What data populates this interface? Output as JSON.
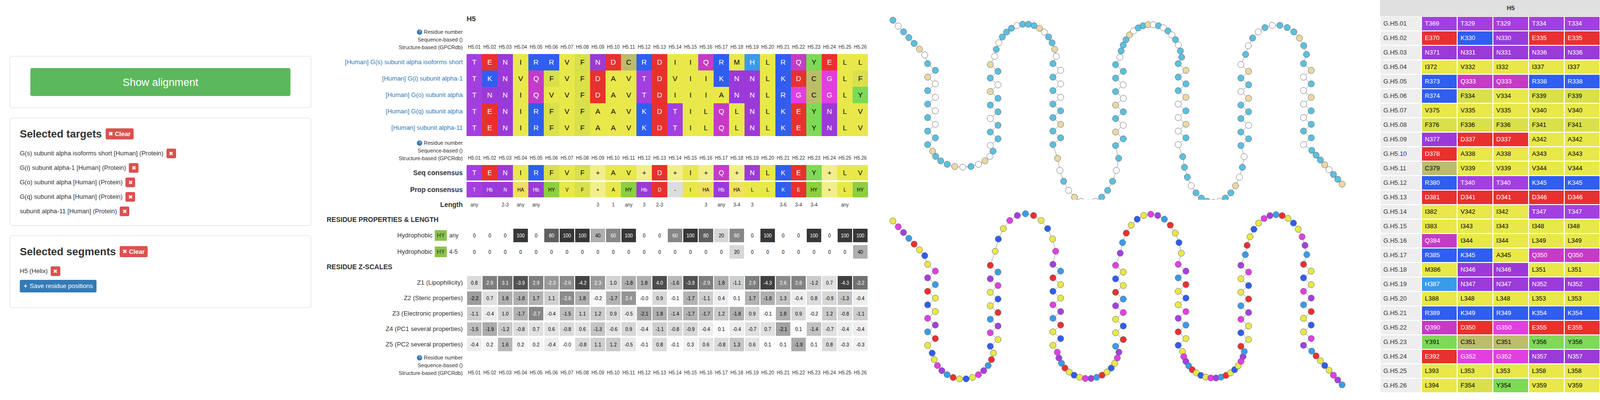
{
  "left_panel": {
    "show_alignment_button": "Show alignment",
    "remove_icon": "✖",
    "selected_targets": {
      "title": "Selected targets",
      "clear": "Clear",
      "items": [
        {
          "label": "G(s) subunit alpha isoforms short [Human] (Protein)"
        },
        {
          "label": "G(i) subunit alpha-1 [Human] (Protein)"
        },
        {
          "label": "G(o) subunit alpha [Human] (Protein)"
        },
        {
          "label": "G(q) subunit alpha [Human] (Protein)"
        },
        {
          "label": "subunit alpha-11 [Human] (Protein)"
        }
      ]
    },
    "selected_segments": {
      "title": "Selected segments",
      "clear": "Clear",
      "items": [
        {
          "label": "H5 (Helix)"
        }
      ],
      "save_icon": "+",
      "save_button": "Save residue positions"
    }
  },
  "alignment": {
    "title": "H5",
    "help_icon": "?",
    "header_labels": [
      "Residue number",
      "Sequence-based ()",
      "Structure-based (GPCRdb)"
    ],
    "residue_numbers": [
      "H5.01",
      "H5.02",
      "H5.03",
      "H5.04",
      "H5.05",
      "H5.06",
      "H5.07",
      "H5.08",
      "H5.09",
      "H5.10",
      "H5.11",
      "H5.12",
      "H5.13",
      "H5.14",
      "H5.15",
      "H5.16",
      "H5.17",
      "H5.18",
      "H5.19",
      "H5.20",
      "H5.21",
      "H5.22",
      "H5.23",
      "H5.24",
      "H5.25",
      "H5.26"
    ],
    "sequences": [
      {
        "name": "[Human] G(s) subunit alpha isoforms short",
        "residues": [
          "T",
          "E",
          "N",
          "I",
          "R",
          "R",
          "V",
          "F",
          "N",
          "D",
          "C",
          "R",
          "D",
          "I",
          "I",
          "Q",
          "R",
          "M",
          "H",
          "L",
          "R",
          "Q",
          "Y",
          "E",
          "L",
          "L"
        ]
      },
      {
        "name": "[Human] G(i) subunit alpha-1",
        "residues": [
          "T",
          "K",
          "N",
          "V",
          "Q",
          "F",
          "V",
          "F",
          "D",
          "A",
          "V",
          "T",
          "D",
          "V",
          "I",
          "I",
          "K",
          "N",
          "N",
          "L",
          "K",
          "D",
          "C",
          "G",
          "L",
          "F"
        ]
      },
      {
        "name": "[Human] G(o) subunit alpha",
        "residues": [
          "T",
          "N",
          "N",
          "I",
          "Q",
          "V",
          "V",
          "F",
          "D",
          "A",
          "V",
          "T",
          "D",
          "I",
          "I",
          "I",
          "A",
          "N",
          "N",
          "L",
          "R",
          "G",
          "C",
          "G",
          "L",
          "Y"
        ]
      },
      {
        "name": "[Human] G(q) subunit alpha",
        "residues": [
          "T",
          "E",
          "N",
          "I",
          "R",
          "F",
          "V",
          "F",
          "A",
          "A",
          "V",
          "K",
          "D",
          "T",
          "I",
          "L",
          "Q",
          "L",
          "N",
          "L",
          "K",
          "E",
          "Y",
          "N",
          "L",
          "V"
        ]
      },
      {
        "name": "[Human] subunit alpha-11",
        "residues": [
          "T",
          "E",
          "N",
          "I",
          "R",
          "F",
          "V",
          "F",
          "A",
          "A",
          "V",
          "K",
          "D",
          "T",
          "I",
          "L",
          "Q",
          "L",
          "N",
          "L",
          "K",
          "E",
          "Y",
          "N",
          "L",
          "V"
        ]
      }
    ],
    "seq_consensus": {
      "label": "Seq consensus",
      "residues": [
        "T",
        "E",
        "N",
        "I",
        "R",
        "F",
        "V",
        "F",
        "+",
        "A",
        "V",
        "+",
        "D",
        "+",
        "I",
        "+",
        "Q",
        "+",
        "N",
        "L",
        "K",
        "E",
        "Y",
        "+",
        "L",
        "V"
      ]
    },
    "prop_consensus": {
      "label": "Prop consensus",
      "items": [
        {
          "text": "T",
          "color": "#a33fe0"
        },
        {
          "text": "Hb",
          "color": "#9b3ad8"
        },
        {
          "text": "N",
          "color": "#9b3ad8"
        },
        {
          "text": "HA",
          "color": "#f0e060"
        },
        {
          "text": "Hb",
          "color": "#9b3ad8"
        },
        {
          "text": "HY",
          "color": "#8ccf3f"
        },
        {
          "text": "V",
          "color": "#e8e84a"
        },
        {
          "text": "F",
          "color": "#d9e04a"
        },
        {
          "text": "+",
          "color": "#f2ee8c"
        },
        {
          "text": "A",
          "color": "#e8e84a"
        },
        {
          "text": "HY",
          "color": "#8ccf3f"
        },
        {
          "text": "Hb",
          "color": "#9b3ad8"
        },
        {
          "text": "D",
          "color": "#e8312f"
        },
        {
          "text": "-",
          "color": "#dddddd"
        },
        {
          "text": "I",
          "color": "#e8e84a"
        },
        {
          "text": "HA",
          "color": "#f0e060"
        },
        {
          "text": "Hb",
          "color": "#9b3ad8"
        },
        {
          "text": "HA",
          "color": "#f0e060"
        },
        {
          "text": "L",
          "color": "#e8e84a"
        },
        {
          "text": "L",
          "color": "#e8e84a"
        },
        {
          "text": "K",
          "color": "#2f5ef0"
        },
        {
          "text": "E",
          "color": "#e8312f"
        },
        {
          "text": "HY",
          "color": "#8ccf3f"
        },
        {
          "text": "+",
          "color": "#f2ee8c"
        },
        {
          "text": "L",
          "color": "#e8e84a"
        },
        {
          "text": "HY",
          "color": "#8ccf3f"
        }
      ]
    },
    "length": {
      "label": "Length",
      "values": [
        "any",
        "",
        "2-3",
        "any",
        "any",
        "",
        "",
        "",
        "3",
        "1",
        "any",
        "3",
        "2-3",
        "",
        "",
        "3",
        "any",
        "3-4",
        "3",
        "",
        "3-6",
        "3-4",
        "3-4",
        "",
        "any",
        ""
      ]
    },
    "properties_title": "RESIDUE PROPERTIES & LENGTH",
    "property_rows": [
      {
        "label": "Hydrophobic",
        "badge": "HY",
        "badge_color": "#8bc34a",
        "qualifier": "any",
        "values": [
          "0",
          "0",
          "0",
          "100",
          "0",
          "80",
          "100",
          "100",
          "40",
          "60",
          "100",
          "0",
          "0",
          "60",
          "100",
          "80",
          "20",
          "60",
          "0",
          "100",
          "0",
          "0",
          "100",
          "0",
          "100",
          "100"
        ]
      },
      {
        "label": "Hydrophobic",
        "badge": "HY",
        "badge_color": "#8bc34a",
        "qualifier": "4-5",
        "values": [
          "0",
          "0",
          "0",
          "0",
          "0",
          "0",
          "0",
          "0",
          "0",
          "0",
          "0",
          "0",
          "0",
          "0",
          "0",
          "0",
          "0",
          "20",
          "0",
          "0",
          "0",
          "0",
          "0",
          "0",
          "0",
          "40"
        ]
      }
    ],
    "zscales_title": "RESIDUE Z-SCALES",
    "zscale_rows": [
      {
        "label": "Z1 (Lipophilicity)",
        "values": [
          "0.8",
          "2.9",
          "3.1",
          "-3.9",
          "2.9",
          "-2.3",
          "-2.6",
          "-4.2",
          "2.3",
          "1.0",
          "-1.8",
          "1.8",
          "4.0",
          "-1.6",
          "-3.9",
          "-2.9",
          "1.8",
          "-1.1",
          "2.9",
          "-4.3",
          "2.6",
          "2.8",
          "-1.2",
          "0.7",
          "-4.3",
          "-3.2"
        ]
      },
      {
        "label": "Z2 (Steric properties)",
        "values": [
          "-2.2",
          "0.7",
          "1.8",
          "-1.8",
          "1.7",
          "1.1",
          "-2.6",
          "1.8",
          "-0.2",
          "-1.7",
          "2.4",
          "-0.0",
          "0.9",
          "-0.1",
          "-1.7",
          "-1.1",
          "0.4",
          "0.1",
          "1.7",
          "-1.8",
          "1.3",
          "-0.4",
          "0.8",
          "-0.9",
          "-1.3",
          "-0.4"
        ]
      },
      {
        "label": "Z3 (Electronic properties)",
        "values": [
          "-1.1",
          "-0.4",
          "1.0",
          "-1.7",
          "-2.7",
          "-0.4",
          "-1.5",
          "1.1",
          "1.2",
          "0.9",
          "-0.5",
          "-2.1",
          "1.8",
          "-1.4",
          "-1.7",
          "-1.7",
          "1.2",
          "-1.8",
          "0.9",
          "-0.1",
          "1.8",
          "0.9",
          "-0.2",
          "1.2",
          "-0.8",
          "-1.1"
        ]
      },
      {
        "label": "Z4 (PC1 several properties)",
        "values": [
          "-1.5",
          "-1.9",
          "-1.2",
          "-0.8",
          "0.7",
          "0.6",
          "-0.8",
          "0.6",
          "-1.3",
          "-0.6",
          "0.9",
          "-0.4",
          "-1.1",
          "-0.8",
          "-0.9",
          "-0.4",
          "0.1",
          "-0.4",
          "-0.7",
          "0.7",
          "-2.1",
          "0.1",
          "-1.4",
          "-0.7",
          "-0.4",
          "-0.4"
        ]
      },
      {
        "label": "Z5 (PC2 several properties)",
        "values": [
          "-0.4",
          "0.2",
          "1.6",
          "0.2",
          "0.2",
          "-0.4",
          "-0.0",
          "-0.8",
          "1.1",
          "1.2",
          "-0.5",
          "-0.1",
          "0.8",
          "-0.1",
          "0.3",
          "0.6",
          "-0.8",
          "1.3",
          "0.6",
          "0.1",
          "0.1",
          "-1.9",
          "0.1",
          "0.8",
          "-0.3",
          "-0.3"
        ]
      }
    ]
  },
  "residue_colors": {
    "A": "#e8e84a",
    "I": "#e8e84a",
    "L": "#e8e84a",
    "V": "#e8e84a",
    "M": "#e8e84a",
    "F": "#d9e04a",
    "Y": "#7ed957",
    "W": "#7ed957",
    "C": "#bcbc6a",
    "G": "#e040e0",
    "P": "#c8a2c8",
    "S": "#a33fe0",
    "T": "#a33fe0",
    "N": "#9b3ad8",
    "Q": "#c53bc5",
    "D": "#e8312f",
    "E": "#e8312f",
    "K": "#2f5ef0",
    "R": "#2f5ef0",
    "H": "#3a9be8",
    "+": "#f2ee8c",
    "-": "#dddddd"
  },
  "snake_plots": [
    {
      "colors": [
        "#5bc0de",
        "#5bc0de",
        "#ffffff",
        "#5bc0de",
        "#e9d8a6",
        "#ffffff",
        "#5bc0de"
      ]
    },
    {
      "colors": [
        "#e8e84a",
        "#a33fe0",
        "#e8312f",
        "#2f5ef0",
        "#8ccf3f",
        "#e040e0",
        "#3a9be8",
        "#e8e84a",
        "#f0a030"
      ]
    }
  ],
  "table": {
    "title": "H5",
    "rows": [
      {
        "label": "G.H5.01",
        "cells": [
          "T369",
          "T329",
          "T329",
          "T334",
          "T334"
        ]
      },
      {
        "label": "G.H5.02",
        "cells": [
          "E370",
          "K330",
          "N330",
          "E335",
          "E335"
        ]
      },
      {
        "label": "G.H5.03",
        "cells": [
          "N371",
          "N331",
          "N331",
          "N336",
          "N336"
        ]
      },
      {
        "label": "G.H5.04",
        "cells": [
          "I372",
          "V332",
          "I332",
          "I337",
          "I337"
        ]
      },
      {
        "label": "G.H5.05",
        "cells": [
          "R373",
          "Q333",
          "Q333",
          "R338",
          "R338"
        ]
      },
      {
        "label": "G.H5.06",
        "cells": [
          "R374",
          "F334",
          "V334",
          "F339",
          "F339"
        ]
      },
      {
        "label": "G.H5.07",
        "cells": [
          "V375",
          "V335",
          "V335",
          "V340",
          "V340"
        ]
      },
      {
        "label": "G.H5.08",
        "cells": [
          "F376",
          "F336",
          "F336",
          "F341",
          "F341"
        ]
      },
      {
        "label": "G.H5.09",
        "cells": [
          "N377",
          "D337",
          "D337",
          "A342",
          "A342"
        ]
      },
      {
        "label": "G.H5.10",
        "cells": [
          "D378",
          "A338",
          "A338",
          "A343",
          "A343"
        ]
      },
      {
        "label": "G.H5.11",
        "cells": [
          "C379",
          "V339",
          "V339",
          "V344",
          "V344"
        ]
      },
      {
        "label": "G.H5.12",
        "cells": [
          "R380",
          "T340",
          "T340",
          "K345",
          "K345"
        ]
      },
      {
        "label": "G.H5.13",
        "cells": [
          "D381",
          "D341",
          "D341",
          "D346",
          "D346"
        ]
      },
      {
        "label": "G.H5.14",
        "cells": [
          "I382",
          "V342",
          "I342",
          "T347",
          "T347"
        ]
      },
      {
        "label": "G.H5.15",
        "cells": [
          "I383",
          "I343",
          "I343",
          "I348",
          "I348"
        ]
      },
      {
        "label": "G.H5.16",
        "cells": [
          "Q384",
          "I344",
          "I344",
          "L349",
          "L349"
        ]
      },
      {
        "label": "G.H5.17",
        "cells": [
          "R385",
          "K345",
          "A345",
          "Q350",
          "Q350"
        ]
      },
      {
        "label": "G.H5.18",
        "cells": [
          "M386",
          "N346",
          "N346",
          "L351",
          "L351"
        ]
      },
      {
        "label": "G.H5.19",
        "cells": [
          "H387",
          "N347",
          "N347",
          "N352",
          "N352"
        ]
      },
      {
        "label": "G.H5.20",
        "cells": [
          "L388",
          "L348",
          "L348",
          "L353",
          "L353"
        ]
      },
      {
        "label": "G.H5.21",
        "cells": [
          "R389",
          "K349",
          "R349",
          "K354",
          "K354"
        ]
      },
      {
        "label": "G.H5.22",
        "cells": [
          "Q390",
          "D350",
          "G350",
          "E355",
          "E355"
        ]
      },
      {
        "label": "G.H5.23",
        "cells": [
          "Y391",
          "C351",
          "C351",
          "Y356",
          "Y356"
        ]
      },
      {
        "label": "G.H5.24",
        "cells": [
          "E392",
          "G352",
          "G352",
          "N357",
          "N357"
        ]
      },
      {
        "label": "G.H5.25",
        "cells": [
          "L393",
          "L353",
          "L353",
          "L358",
          "L358"
        ]
      },
      {
        "label": "G.H5.26",
        "cells": [
          "L394",
          "F354",
          "Y354",
          "V359",
          "V359"
        ]
      }
    ]
  }
}
